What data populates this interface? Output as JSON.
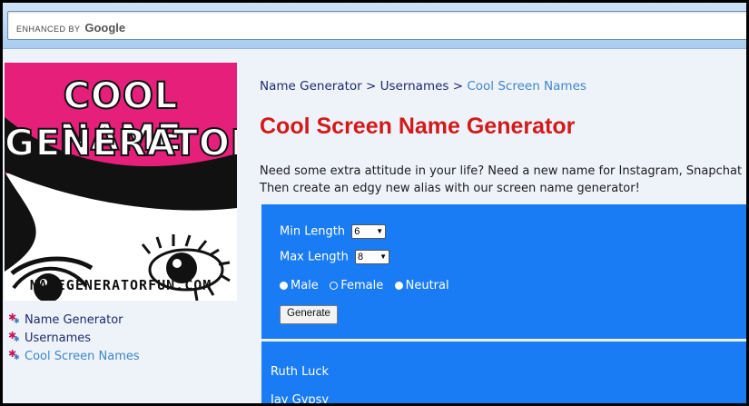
{
  "browser": {
    "search_label": "ENHANCED BY",
    "search_brand": "Google"
  },
  "logo": {
    "line1": "COOL NAME",
    "line2": "GENERATOR",
    "site": "NAMEGENERATORFUN.COM"
  },
  "sidebar": {
    "items": [
      {
        "label": "Name Generator"
      },
      {
        "label": "Usernames"
      },
      {
        "label": "Cool Screen Names"
      }
    ]
  },
  "breadcrumb": {
    "items": [
      "Name Generator",
      "Usernames",
      "Cool Screen Names"
    ],
    "separator": ">"
  },
  "page": {
    "title": "Cool Screen Name Generator",
    "intro_line1": "Need some extra attitude in your life? Need a new name for Instagram, Snapchat or YouT",
    "intro_line2": "Then create an edgy new alias with our screen name generator!"
  },
  "form": {
    "min_label": "Min Length",
    "min_value": "6",
    "max_label": "Max Length",
    "max_value": "8",
    "gender_options": [
      "Male",
      "Female",
      "Neutral"
    ],
    "selected_gender": "Female",
    "generate_label": "Generate"
  },
  "results": {
    "names": [
      "Ruth Luck",
      "Jay Gypsy"
    ]
  },
  "colors": {
    "accent_blue": "#1a7cf4",
    "title_red": "#d21a1a",
    "brand_pink": "#e6207a",
    "link_navy": "#1f2a6b",
    "link_active": "#3f87c8"
  }
}
